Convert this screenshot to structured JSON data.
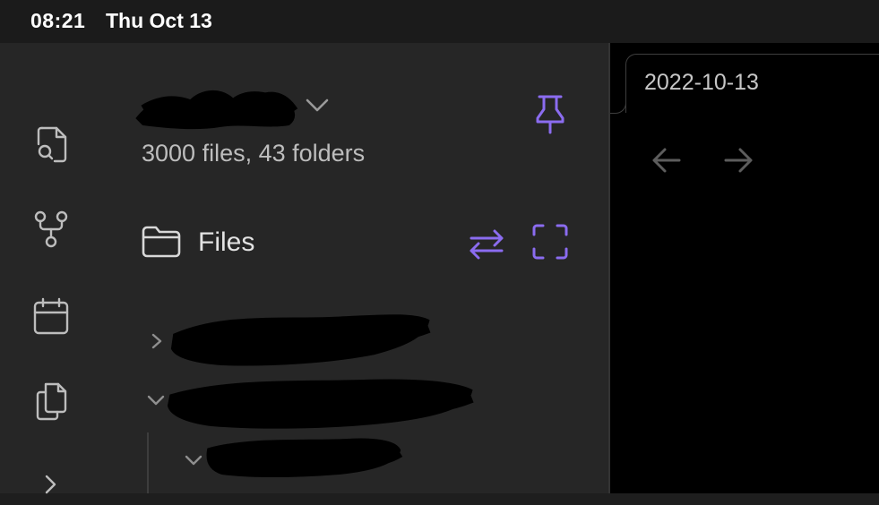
{
  "status_bar": {
    "time": "08:21",
    "date": "Thu Oct 13"
  },
  "ribbon": {
    "items": [
      {
        "icon": "file-search-icon"
      },
      {
        "icon": "graph-view-icon"
      },
      {
        "icon": "calendar-icon"
      },
      {
        "icon": "copy-files-icon"
      },
      {
        "icon": "chevron-right-icon"
      }
    ]
  },
  "sidebar": {
    "vault_stats": "3000 files, 43 folders",
    "files_title": "Files",
    "accent_color": "#8b6cf0"
  },
  "tab": {
    "title": "2022-10-13"
  },
  "colors": {
    "sidebar_bg": "#262626",
    "main_bg": "#000000",
    "accent": "#8b6cf0"
  }
}
